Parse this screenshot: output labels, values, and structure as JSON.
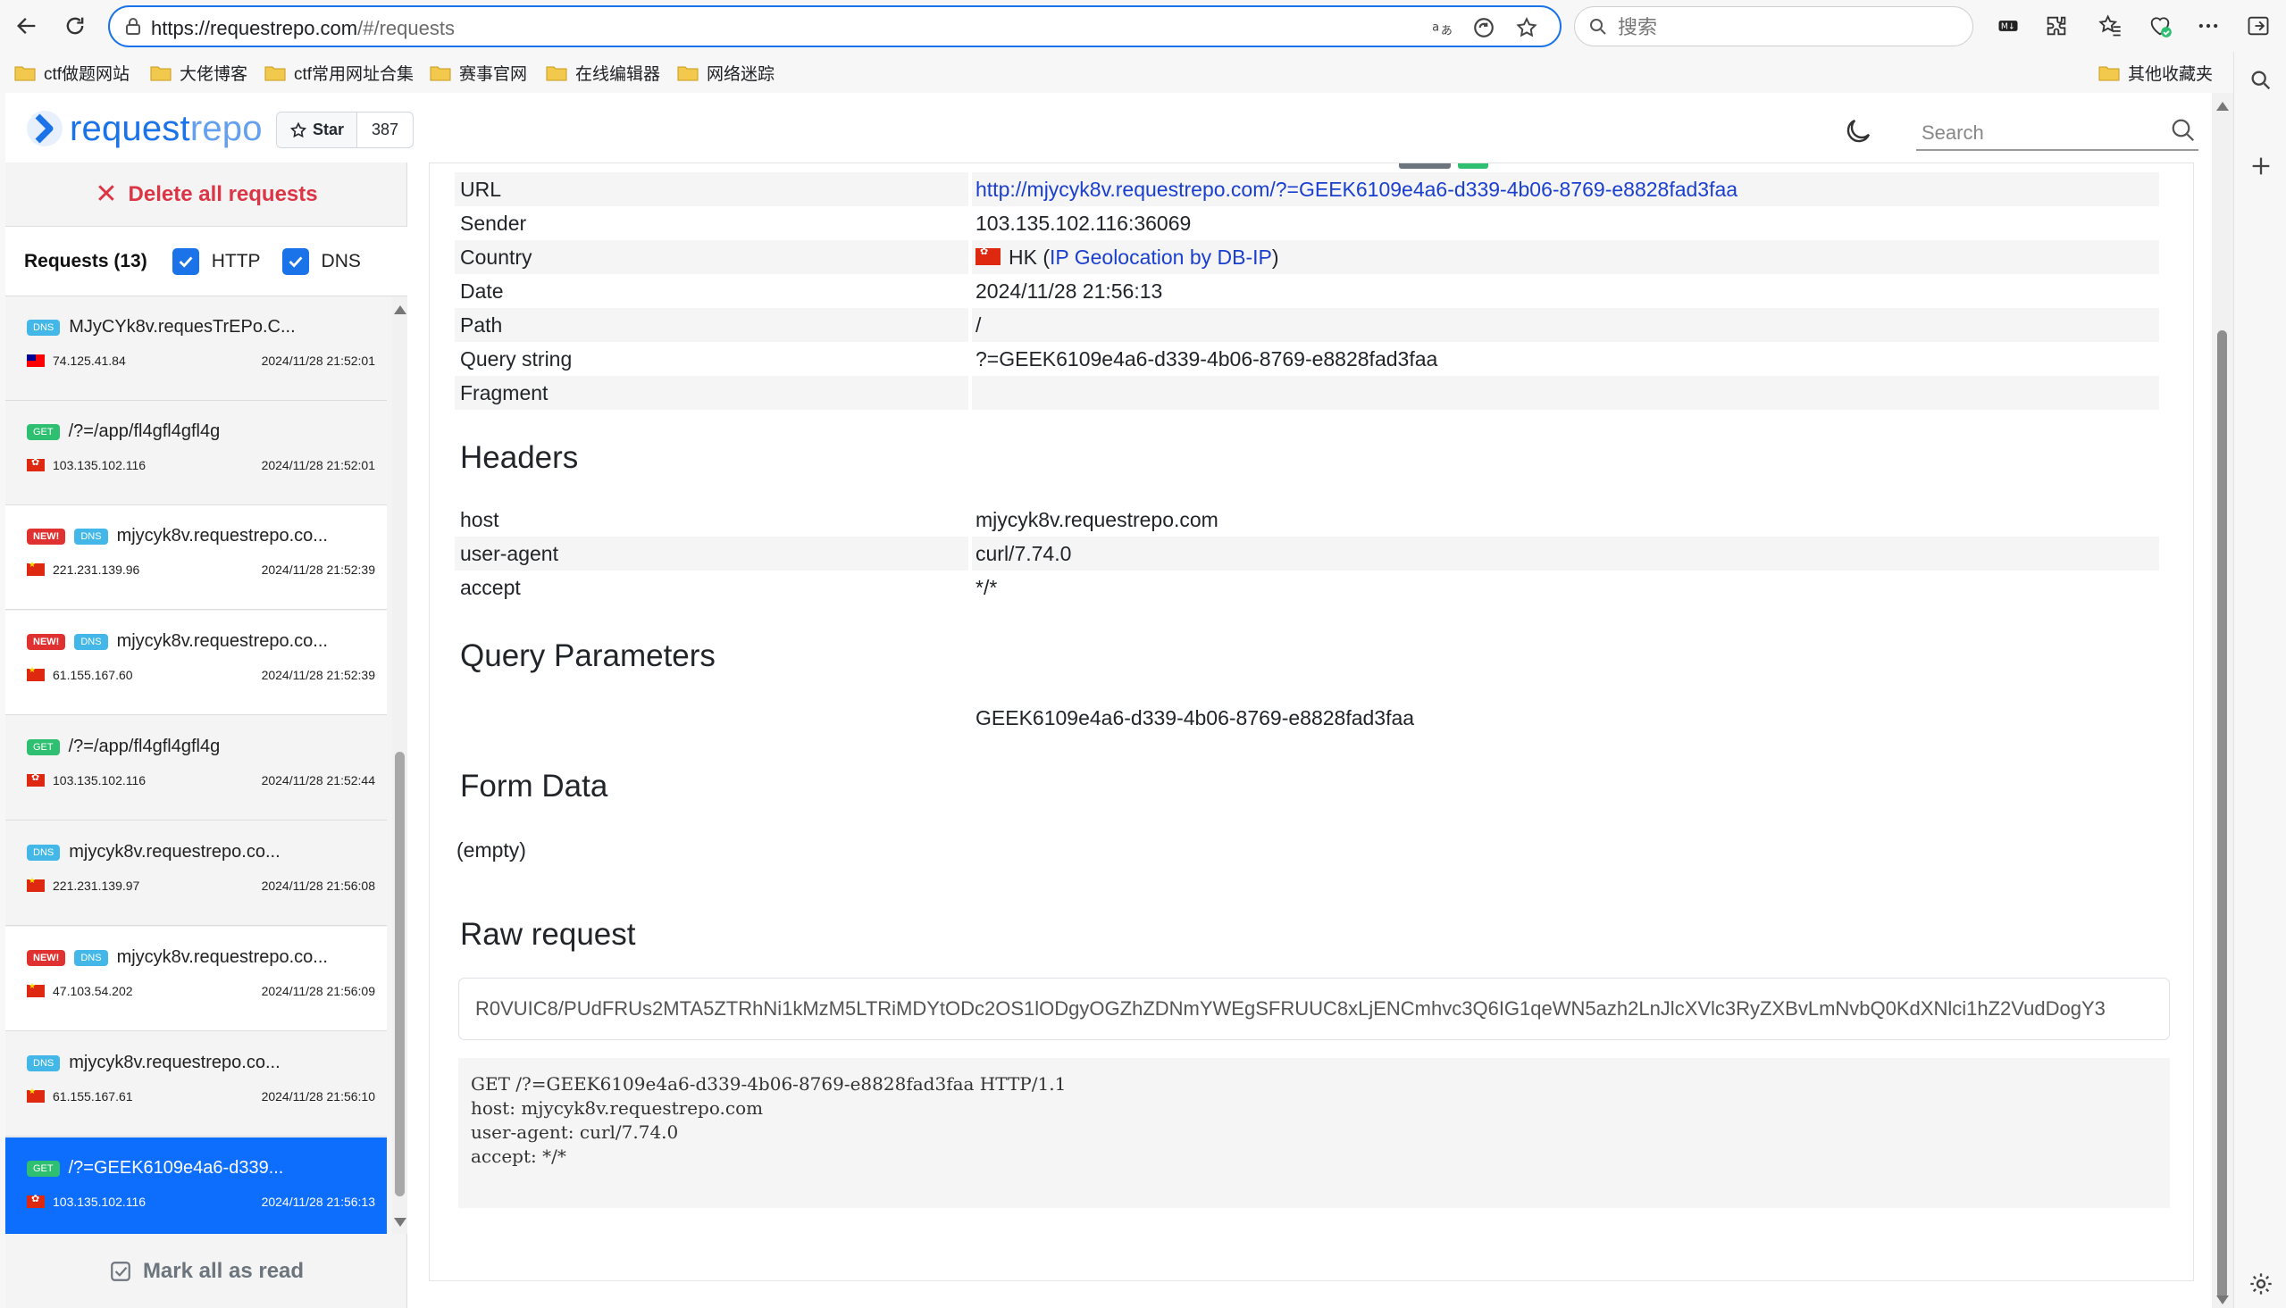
{
  "browser": {
    "url_host": "https://requestrepo.com",
    "url_path": "/#/requests",
    "search_placeholder": "搜索",
    "bookmarks": [
      "ctf做题网站",
      "大佬博客",
      "ctf常用网址合集",
      "赛事官网",
      "在线编辑器",
      "网络迷踪"
    ],
    "other_bookmarks": "其他收藏夹"
  },
  "header": {
    "logo_main": "request",
    "logo_rest": "repo",
    "star_label": "Star",
    "star_count": "387",
    "search_placeholder": "Search"
  },
  "sidebar": {
    "delete_all": "Delete all requests",
    "requests_label": "Requests (13)",
    "filter_http": "HTTP",
    "filter_dns": "DNS",
    "mark_all_read": "Mark all as read",
    "items": [
      {
        "badges": [
          "DNS"
        ],
        "title": "MJyCYk8v.requesTrEPo.C...",
        "flag": "tw",
        "ip": "74.125.41.84",
        "time": "2024/11/28 21:52:01"
      },
      {
        "badges": [
          "GET"
        ],
        "title": "/?=/app/fl4gfl4gfl4g",
        "flag": "hk",
        "ip": "103.135.102.116",
        "time": "2024/11/28 21:52:01"
      },
      {
        "badges": [
          "NEW!",
          "DNS"
        ],
        "title": "mjycyk8v.requestrepo.co...",
        "flag": "cn",
        "ip": "221.231.139.96",
        "time": "2024/11/28 21:52:39"
      },
      {
        "badges": [
          "NEW!",
          "DNS"
        ],
        "title": "mjycyk8v.requestrepo.co...",
        "flag": "cn",
        "ip": "61.155.167.60",
        "time": "2024/11/28 21:52:39"
      },
      {
        "badges": [
          "GET"
        ],
        "title": "/?=/app/fl4gfl4gfl4g",
        "flag": "hk",
        "ip": "103.135.102.116",
        "time": "2024/11/28 21:52:44"
      },
      {
        "badges": [
          "DNS"
        ],
        "title": "mjycyk8v.requestrepo.co...",
        "flag": "cn",
        "ip": "221.231.139.97",
        "time": "2024/11/28 21:56:08"
      },
      {
        "badges": [
          "NEW!",
          "DNS"
        ],
        "title": "mjycyk8v.requestrepo.co...",
        "flag": "cn",
        "ip": "47.103.54.202",
        "time": "2024/11/28 21:56:09"
      },
      {
        "badges": [
          "DNS"
        ],
        "title": "mjycyk8v.requestrepo.co...",
        "flag": "cn",
        "ip": "61.155.167.61",
        "time": "2024/11/28 21:56:10"
      },
      {
        "badges": [
          "GET"
        ],
        "title": "/?=GEEK6109e4a6-d339...",
        "flag": "hk",
        "ip": "103.135.102.116",
        "time": "2024/11/28 21:56:13"
      }
    ]
  },
  "details": {
    "rows": [
      {
        "label": "URL",
        "value": "http://mjycyk8v.requestrepo.com/?=GEEK6109e4a6-d339-4b06-8769-e8828fad3faa"
      },
      {
        "label": "Sender",
        "value": "103.135.102.116:36069"
      },
      {
        "label": "Country",
        "value": "HK"
      },
      {
        "label": "Date",
        "value": "2024/11/28 21:56:13"
      },
      {
        "label": "Path",
        "value": "/"
      },
      {
        "label": "Query string",
        "value": "?=GEEK6109e4a6-d339-4b06-8769-e8828fad3faa"
      },
      {
        "label": "Fragment",
        "value": ""
      }
    ],
    "geo_link": "IP Geolocation by DB-IP",
    "headers_title": "Headers",
    "headers": [
      {
        "label": "host",
        "value": "mjycyk8v.requestrepo.com"
      },
      {
        "label": "user-agent",
        "value": "curl/7.74.0"
      },
      {
        "label": "accept",
        "value": "*/*"
      }
    ],
    "query_title": "Query Parameters",
    "query_value": "GEEK6109e4a6-d339-4b06-8769-e8828fad3faa",
    "form_title": "Form Data",
    "form_value": "(empty)",
    "raw_title": "Raw request",
    "raw_base64": "R0VUIC8/PUdFRUs2MTA5ZTRhNi1kMzM5LTRiMDYtODc2OS1lODgyOGZhZDNmYWEgSFRUUC8xLjENCmhvc3Q6IG1qeWN5azh2LnJlcXVlc3RyZXBvLmNvbQ0KdXNlci1hZ2VudDogY3",
    "raw_text": "GET /?=GEEK6109e4a6-d339-4b06-8769-e8828fad3faa HTTP/1.1\nhost: mjycyk8v.requestrepo.com\nuser-agent: curl/7.74.0\naccept: */*"
  },
  "colors": {
    "accent": "#0d6efd",
    "danger": "#dc3545",
    "dns_badge": "#43b8e8",
    "get_badge": "#2fbf71",
    "new_badge": "#e03131"
  }
}
